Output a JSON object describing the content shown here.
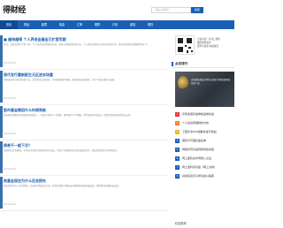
{
  "header": {
    "logo": "得财经",
    "search_placeholder": "请输入关键词",
    "search_button": "搜索"
  },
  "nav": {
    "items": [
      "首页",
      "财经",
      "股票",
      "基金",
      "汇率",
      "理财",
      "行情",
      "保险",
      "期货"
    ]
  },
  "articles": [
    {
      "title": "■ 越来越得 个人养老金基金又扩容写期",
      "text": "近日，证监会发布了第一批…个人养老金投资基金名录，基金公司纷纷推出产品。个人养老金基金产品名单持续扩容，养老金投资市场规模不断扩大。",
      "date": "2023-06-21"
    },
    {
      "title": "保代发行重新配生元区进去场重",
      "text": "多家券商发行新的投资产品，投资者关注度提升，市场情绪逐步回暖，相关板块表现活跃，多只个股出现较大涨幅。",
      "date": "2023-06-20"
    },
    {
      "title": "股市基金赎回什么时候到账",
      "text": "基金赎回到账时间因基金类型而异，一般货币基金T+1到账，股票基金T+3到账，QDII基金时间较长，投资者需提前规划资金安排。",
      "date": "2023-06-20"
    },
    {
      "title": "债券不一般下月？",
      "text": "近期债市走势震荡，市场对于债券后续表现存在分歧，专家认为短期内仍以区间波动为主，建议投资者关注利率变化。",
      "date": "2023-06-19"
    },
    {
      "title": "卖基金现在为什么还会损失",
      "text": "基金投资存在一定的风险，卖出时可能出现亏损，投资者需要了解基金的费用结构及净值波动，理性看待短期收益变化。",
      "date": "2023-06-19"
    }
  ],
  "sidebar": {
    "qr_text": [
      "记者关注一关注二维码",
      "跟踪财经发布",
      "服务有真机 快速报告"
    ],
    "hot_label": "点击排行",
    "banner_text": "高质量发展成为经济主旋律 新型能源领域前景广阔",
    "rank_items": [
      "养老金保养金券和金券基金",
      "个人投资者理财的方向",
      "工银沪深300指数基金与收益",
      "国际与代理基金名单",
      "网络货币基金转换到投资组",
      "网上面实在市场收入之后",
      "网上金科买基金（网上交易）",
      "基金投资怎么样基金以股票"
    ],
    "rank_colors": [
      "#e23b3b",
      "#f07f2a",
      "#f0b22a",
      "#1a5fb4",
      "#1a5fb4",
      "#1a5fb4",
      "#1a5fb4",
      "#1a5fb4"
    ],
    "foot_label": "精选推荐"
  }
}
